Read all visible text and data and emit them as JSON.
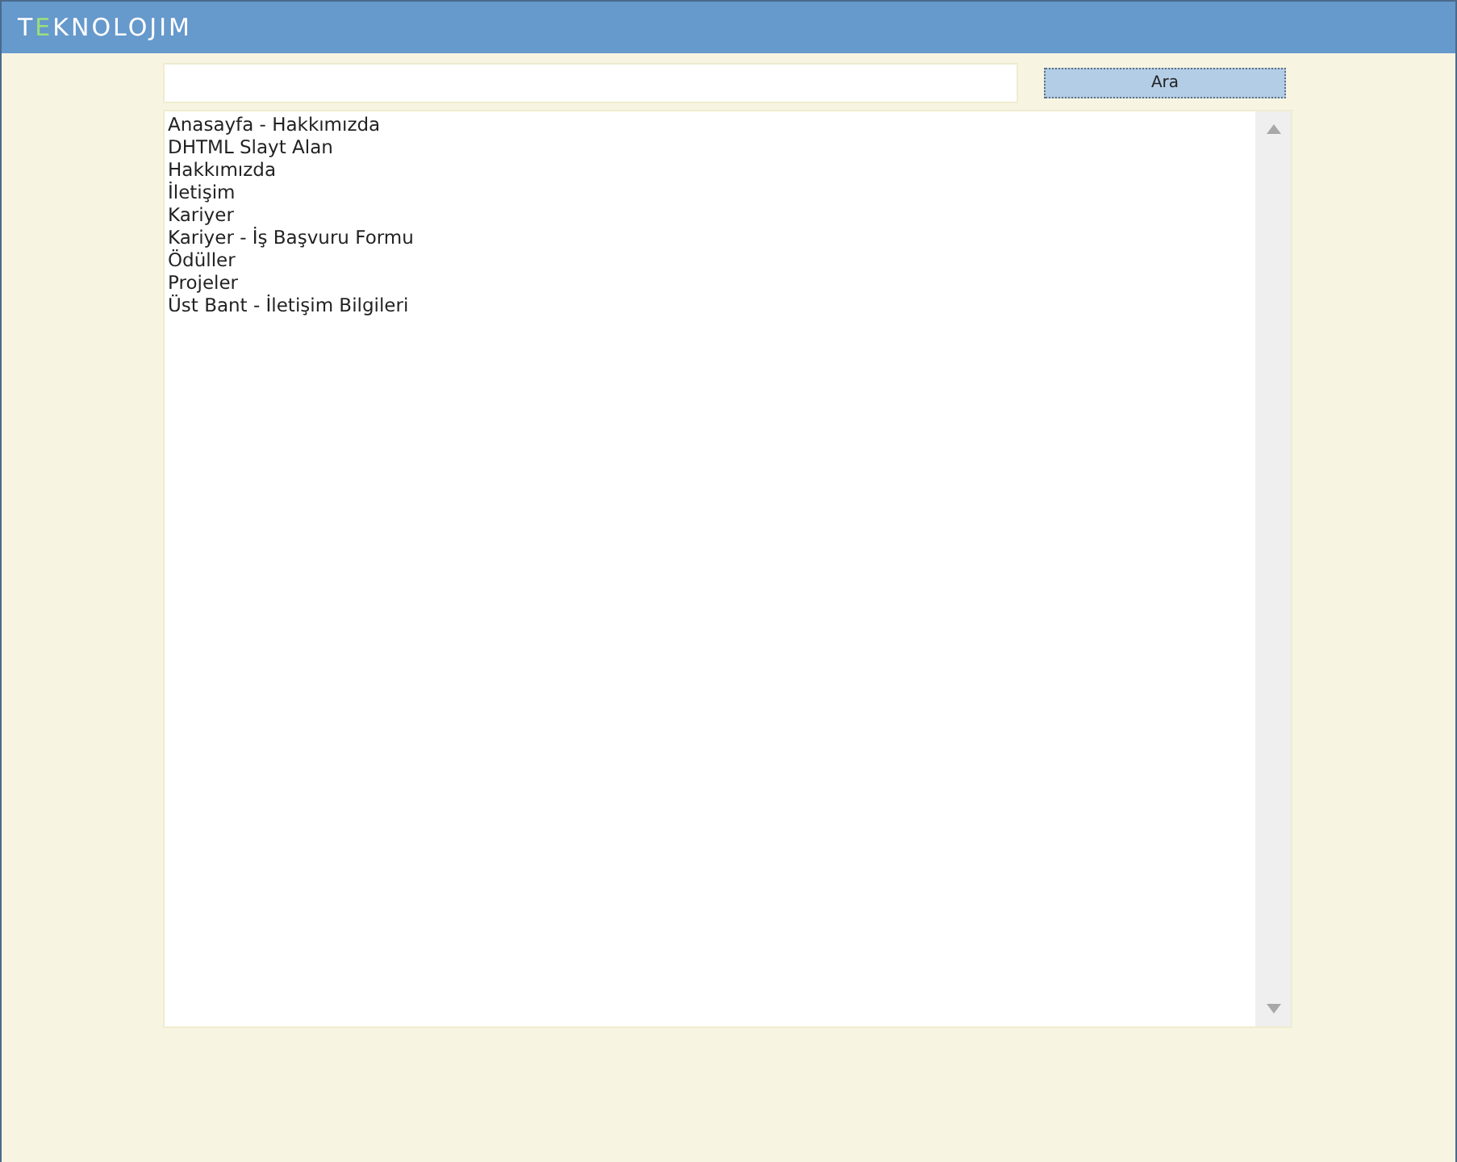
{
  "header": {
    "logo": "TEKNOLOJIM"
  },
  "search": {
    "button": "Ara"
  },
  "list": {
    "items": [
      "Anasayfa - Hakkımızda",
      "DHTML Slayt Alan",
      "Hakkımızda",
      "İletişim",
      "Kariyer",
      "Kariyer - İş Başvuru Formu",
      "Ödüller",
      "Projeler",
      "Üst Bant - İletişim Bilgileri"
    ]
  }
}
